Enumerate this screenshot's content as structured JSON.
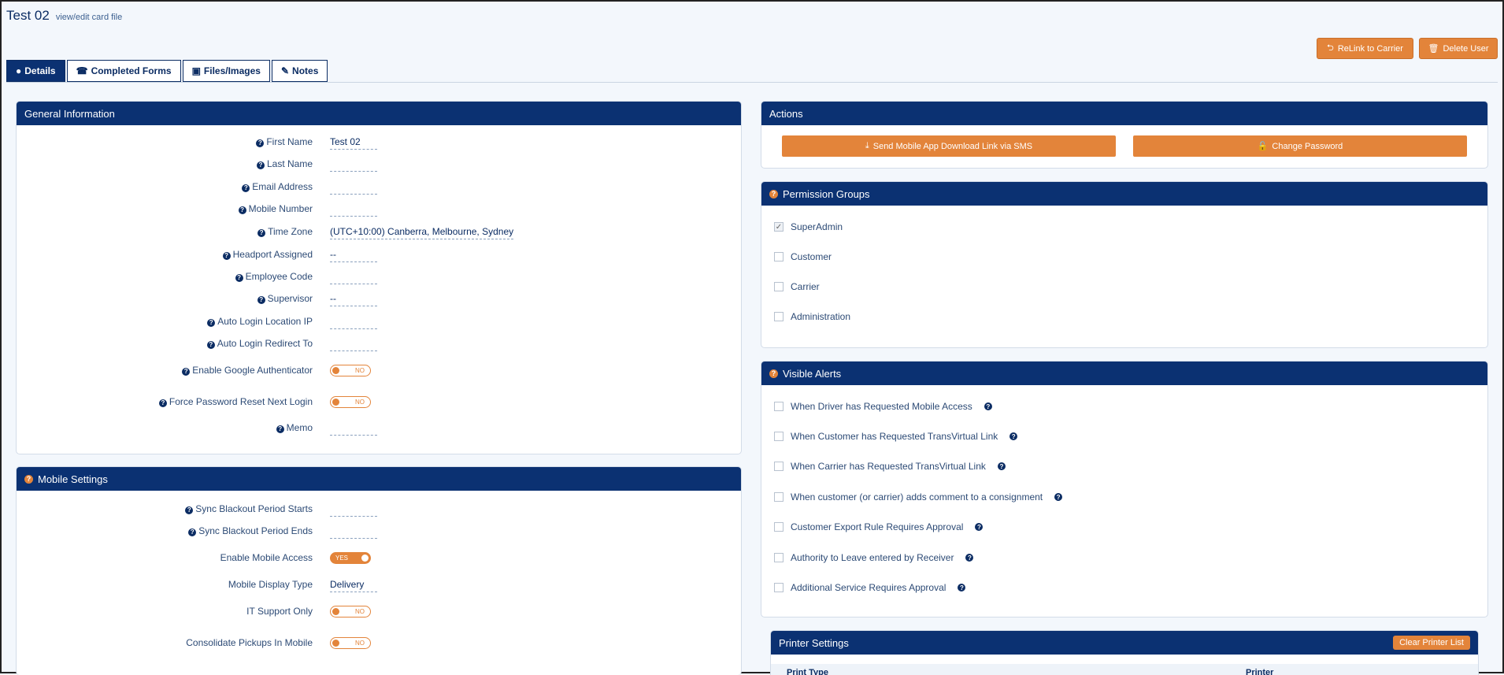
{
  "header": {
    "title": "Test 02",
    "subtitle": "view/edit card file"
  },
  "top_actions": {
    "relink": "ReLink to Carrier",
    "delete": "Delete User"
  },
  "tabs": [
    {
      "label": "Details",
      "icon": "user-icon"
    },
    {
      "label": "Completed Forms",
      "icon": "phone-icon"
    },
    {
      "label": "Files/Images",
      "icon": "image-file-icon"
    },
    {
      "label": "Notes",
      "icon": "pencil-icon"
    }
  ],
  "general": {
    "title": "General Information",
    "fields": [
      {
        "label": "First Name",
        "value": "Test 02"
      },
      {
        "label": "Last Name",
        "value": ""
      },
      {
        "label": "Email Address",
        "value": ""
      },
      {
        "label": "Mobile Number",
        "value": ""
      },
      {
        "label": "Time Zone",
        "value": "(UTC+10:00) Canberra, Melbourne, Sydney"
      },
      {
        "label": "Headport Assigned",
        "value": "--"
      },
      {
        "label": "Employee Code",
        "value": ""
      },
      {
        "label": "Supervisor",
        "value": "--"
      },
      {
        "label": "Auto Login Location IP",
        "value": ""
      },
      {
        "label": "Auto Login Redirect To",
        "value": ""
      }
    ],
    "google_auth": {
      "label": "Enable Google Authenticator",
      "state": "NO"
    },
    "force_reset": {
      "label": "Force Password Reset Next Login",
      "state": "NO"
    },
    "memo": {
      "label": "Memo",
      "value": ""
    }
  },
  "mobile": {
    "title": "Mobile Settings",
    "blackout_start": {
      "label": "Sync Blackout Period Starts",
      "value": ""
    },
    "blackout_end": {
      "label": "Sync Blackout Period Ends",
      "value": ""
    },
    "mobile_access": {
      "label": "Enable Mobile Access",
      "state": "YES"
    },
    "display_type": {
      "label": "Mobile Display Type",
      "value": "Delivery"
    },
    "it_support": {
      "label": "IT Support Only",
      "state": "NO"
    },
    "consolidate": {
      "label": "Consolidate Pickups In Mobile",
      "state": "NO"
    }
  },
  "actions": {
    "title": "Actions",
    "send_sms": "Send Mobile App Download Link via SMS",
    "change_password": "Change Password"
  },
  "permissions": {
    "title": "Permission Groups",
    "items": [
      {
        "label": "SuperAdmin",
        "checked": true
      },
      {
        "label": "Customer",
        "checked": false
      },
      {
        "label": "Carrier",
        "checked": false
      },
      {
        "label": "Administration",
        "checked": false
      }
    ]
  },
  "alerts": {
    "title": "Visible Alerts",
    "items": [
      {
        "label": "When Driver has Requested Mobile Access"
      },
      {
        "label": "When Customer has Requested TransVirtual Link"
      },
      {
        "label": "When Carrier has Requested TransVirtual Link"
      },
      {
        "label": "When customer (or carrier) adds comment to a consignment"
      },
      {
        "label": "Customer Export Rule Requires Approval"
      },
      {
        "label": "Authority to Leave entered by Receiver"
      },
      {
        "label": "Additional Service Requires Approval"
      }
    ]
  },
  "printer": {
    "title": "Printer Settings",
    "clear_label": "Clear Printer List",
    "columns": [
      "Print Type",
      "Printer"
    ]
  },
  "colors": {
    "primary": "#0b3172",
    "accent": "#e3843a",
    "text": "#2c4a75"
  }
}
